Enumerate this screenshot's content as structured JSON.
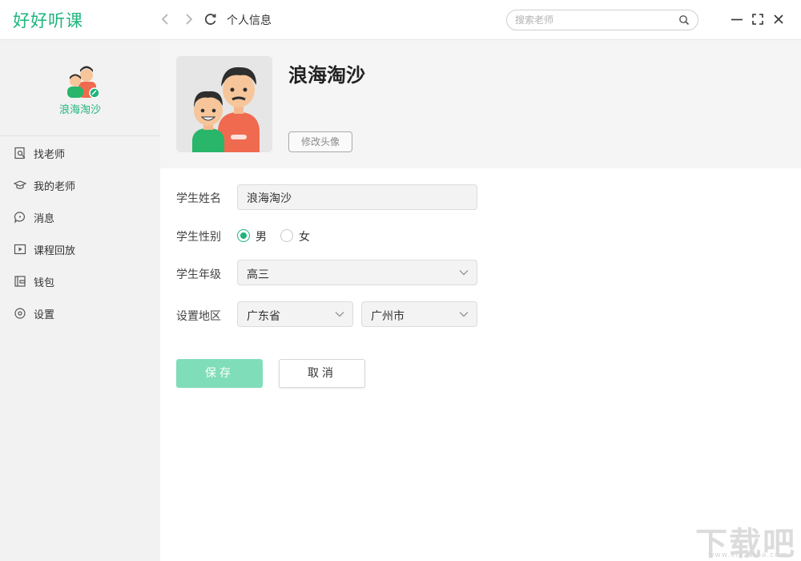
{
  "app": {
    "logo_text": "好好听课",
    "page_title": "个人信息",
    "brand_color": "#1fb57d"
  },
  "search": {
    "placeholder": "搜索老师",
    "icon": "search-icon"
  },
  "window_controls": [
    "minimize-icon",
    "maximize-icon",
    "close-icon"
  ],
  "sidebar": {
    "profile_name": "浪海淘沙",
    "items": [
      {
        "label": "找老师",
        "icon": "find-teacher-icon"
      },
      {
        "label": "我的老师",
        "icon": "graduation-cap-icon"
      },
      {
        "label": "消息",
        "icon": "message-icon"
      },
      {
        "label": "课程回放",
        "icon": "playback-icon"
      },
      {
        "label": "钱包",
        "icon": "wallet-icon"
      },
      {
        "label": "设置",
        "icon": "settings-icon"
      }
    ]
  },
  "header": {
    "name": "浪海淘沙",
    "change_avatar_label": "修改头像"
  },
  "form": {
    "name_label": "学生姓名",
    "name_value": "浪海淘沙",
    "gender_label": "学生性别",
    "gender_options": [
      {
        "label": "男",
        "checked": true
      },
      {
        "label": "女",
        "checked": false
      }
    ],
    "grade_label": "学生年级",
    "grade_value": "高三",
    "region_label": "设置地区",
    "province_value": "广东省",
    "city_value": "广州市"
  },
  "actions": {
    "save_label": "保存",
    "cancel_label": "取消"
  },
  "watermark": {
    "text": "下载吧",
    "url": "www.xiazaiba.com"
  }
}
